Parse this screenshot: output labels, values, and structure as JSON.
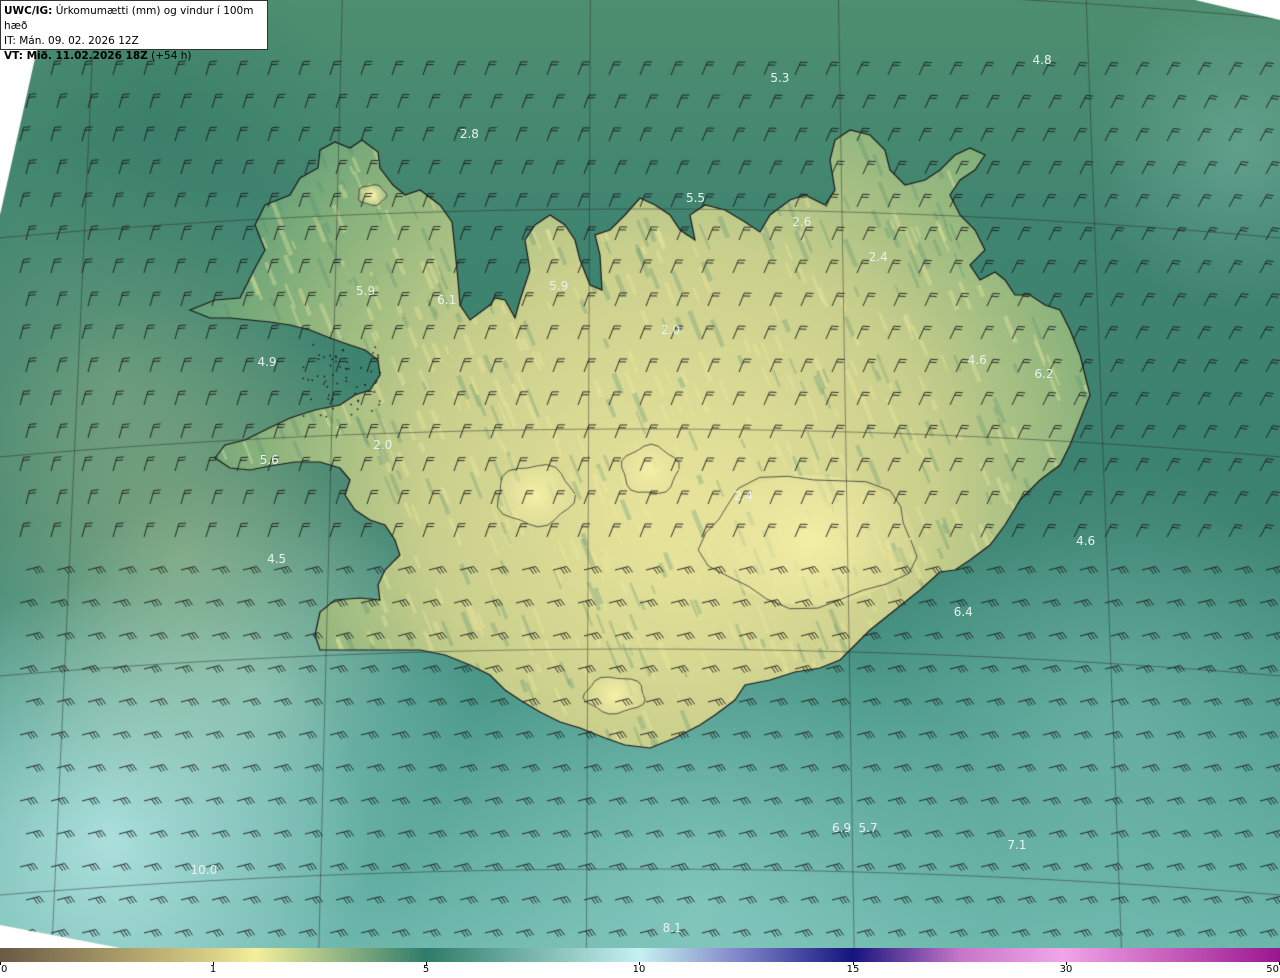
{
  "header": {
    "model_code": "UWC/IG:",
    "title_rest": "Úrkomumætti (mm) og vindur í 100m hæð",
    "it_line": "IT: Mán. 09. 02. 2026 12Z",
    "vt_bold": "VT: Mið. 11.02.2026 18Z",
    "vt_rest": "(+54 h)"
  },
  "value_labels": [
    {
      "text": "4.8",
      "lon": -10.9,
      "lat": 66.95
    },
    {
      "text": "5.3",
      "lon": -16.2,
      "lat": 66.6
    },
    {
      "text": "2.8",
      "lon": -22.4,
      "lat": 66.35
    },
    {
      "text": "5.5",
      "lon": -17.9,
      "lat": 66.05
    },
    {
      "text": "2.6",
      "lon": -15.8,
      "lat": 65.95
    },
    {
      "text": "2.4",
      "lon": -14.3,
      "lat": 65.8
    },
    {
      "text": "5.9",
      "lon": -24.4,
      "lat": 65.65
    },
    {
      "text": "6.1",
      "lon": -22.8,
      "lat": 65.6
    },
    {
      "text": "5.9",
      "lon": -20.6,
      "lat": 65.65
    },
    {
      "text": "2.0",
      "lon": -18.4,
      "lat": 65.45
    },
    {
      "text": "4.9",
      "lon": -26.3,
      "lat": 65.35
    },
    {
      "text": "4.6",
      "lon": -12.4,
      "lat": 65.35
    },
    {
      "text": "6.2",
      "lon": -11.1,
      "lat": 65.3
    },
    {
      "text": "2.0",
      "lon": -24.0,
      "lat": 64.95
    },
    {
      "text": "5.6",
      "lon": -26.2,
      "lat": 64.9
    },
    {
      "text": "2.4",
      "lon": -17.0,
      "lat": 64.7
    },
    {
      "text": "4.5",
      "lon": -26.0,
      "lat": 64.45
    },
    {
      "text": "4.6",
      "lon": -10.4,
      "lat": 64.55
    },
    {
      "text": "6.4",
      "lon": -12.8,
      "lat": 64.2
    },
    {
      "text": "6.9",
      "lon": -15.2,
      "lat": 63.2
    },
    {
      "text": "5.7",
      "lon": -14.7,
      "lat": 63.2
    },
    {
      "text": "7.1",
      "lon": -11.9,
      "lat": 63.15
    },
    {
      "text": "10.0",
      "lon": -27.2,
      "lat": 63.05
    },
    {
      "text": "8.1",
      "lon": -18.4,
      "lat": 62.65
    }
  ],
  "colorbar": {
    "ticks": [
      "0",
      "1",
      "5",
      "10",
      "15",
      "30",
      "50"
    ],
    "colors": [
      "#6b5a44",
      "#d9cf85",
      "#f4ef9c",
      "#2f7c6a",
      "#c6f1f1",
      "#7e82c8",
      "#16147e",
      "#c776c9",
      "#f1a6e9",
      "#9a168f"
    ]
  }
}
